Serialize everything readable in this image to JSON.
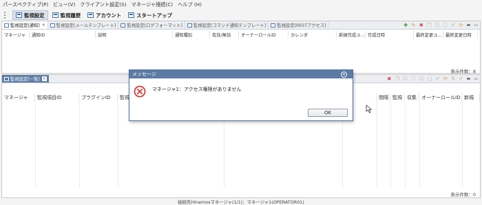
{
  "menu": [
    "パースペクティブ(P)",
    "ビュー(V)",
    "クライアント設定(S)",
    "マネージャ接続(C)",
    "ヘルプ (H)"
  ],
  "perspectives": [
    "監視設定",
    "監視履歴",
    "アカウント",
    "スタートアップ"
  ],
  "top_view": {
    "tabs": [
      "監視設定[通知]",
      "監視設定[メールテンプレート]",
      "監視設定[ログフォーマット]",
      "監視設定[コマンド通知テンプレート]",
      "監視設定[RESTアクセス]"
    ],
    "columns": [
      "マネージャ",
      "通知ID",
      "説明",
      "通知種別",
      "有効/無効",
      "オーナーロールID",
      "カレンダ",
      "新規作成ユ...",
      "作成日時",
      "最終変更ユ...",
      "最終変更日時"
    ],
    "count_label": "表示件数：8"
  },
  "bottom_view": {
    "tab": "監視設定[一覧]",
    "columns_left": [
      "マネージャ",
      "監視項目ID",
      "プラグインID",
      "監視種"
    ],
    "columns_right": [
      "ブ",
      "間隔",
      "監視",
      "収集",
      "オーナーロールID",
      "新規"
    ],
    "count_label": "表示件数：0"
  },
  "dialog": {
    "title": "メッセージ",
    "message": "マネージャ1：アクセス権限がありません",
    "ok_label": "OK"
  },
  "status": "接続先Hinemosマネージャ(1/1)：マネージャ1(OPERATOR01)",
  "colors": {
    "titlebar": "#5b7ba5",
    "error": "#d93a3a",
    "accent": "#3d6fa8"
  }
}
